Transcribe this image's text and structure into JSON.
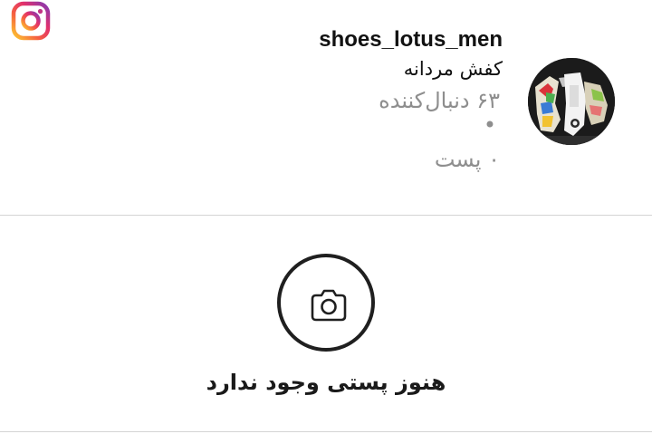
{
  "header": {
    "logo_icon": "instagram-icon",
    "username": "shoes_lotus_men",
    "bio": "کفش مردانه",
    "followers": "۶۳ دنبال‌کننده",
    "separator": "•",
    "posts": "۰ پست",
    "avatar_icon": "profile-photo-shoes"
  },
  "empty_state": {
    "icon": "camera-icon",
    "message": "هنوز پستی وجود ندارد"
  },
  "colors": {
    "text_primary": "#111111",
    "text_secondary": "#8e8e8e",
    "divider": "#d4d4d4"
  }
}
